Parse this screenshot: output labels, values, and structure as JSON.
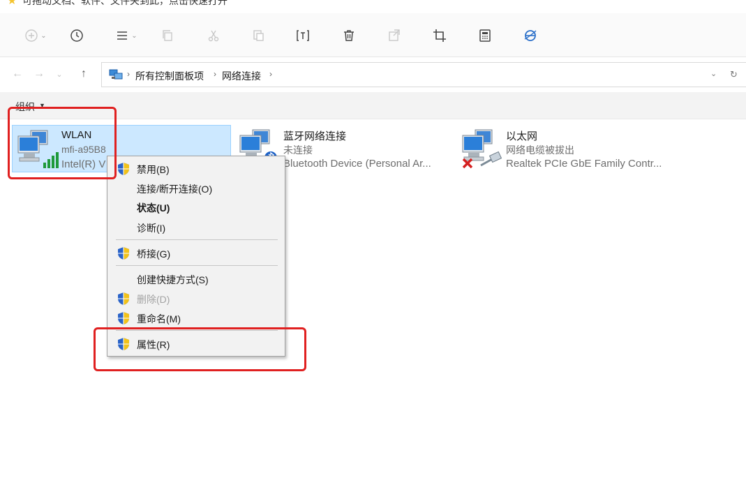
{
  "hint": {
    "text": "可拖动文档、软件、文件夹到此，点击快速打开"
  },
  "breadcrumb": {
    "items": [
      "所有控制面板项",
      "网络连接"
    ],
    "separator": "›"
  },
  "organize": {
    "label": "组织"
  },
  "connections": [
    {
      "name": "WLAN",
      "status": "mfi-a95B8",
      "device": "Intel(R) V"
    },
    {
      "name": "蓝牙网络连接",
      "status": "未连接",
      "device": "Bluetooth Device (Personal Ar..."
    },
    {
      "name": "以太网",
      "status": "网络电缆被拔出",
      "device": "Realtek PCIe GbE Family Contr..."
    }
  ],
  "context_menu": {
    "items": [
      {
        "label": "禁用(B)",
        "shield": true
      },
      {
        "label": "连接/断开连接(O)",
        "shield": false
      },
      {
        "label": "状态(U)",
        "shield": false,
        "bold": true
      },
      {
        "label": "诊断(I)",
        "shield": false
      },
      {
        "label": "桥接(G)",
        "shield": true
      },
      {
        "label": "创建快捷方式(S)",
        "shield": false
      },
      {
        "label": "删除(D)",
        "shield": true,
        "disabled": true
      },
      {
        "label": "重命名(M)",
        "shield": true
      },
      {
        "label": "属性(R)",
        "shield": true
      }
    ]
  },
  "colors": {
    "selection": "#cce8ff",
    "annotation_red": "#e02020",
    "shield_blue": "#2a63c8",
    "shield_yellow": "#f2c21a"
  },
  "icons": {
    "toolbar": [
      "add-icon",
      "history-icon",
      "view-list-icon",
      "copy-icon",
      "cut-icon",
      "paste-icon",
      "rename-icon",
      "delete-icon",
      "share-icon",
      "crop-icon",
      "calculator-icon",
      "browser-icon"
    ]
  }
}
